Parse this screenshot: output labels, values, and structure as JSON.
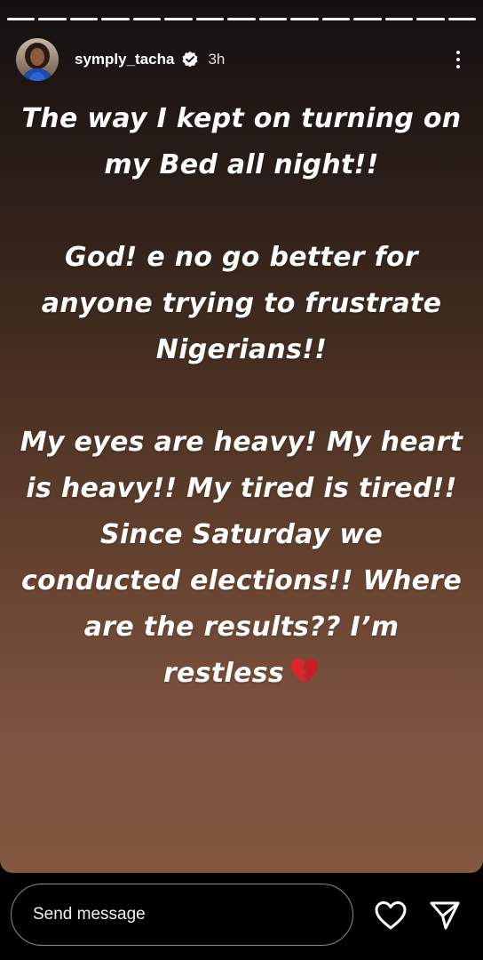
{
  "story": {
    "author": {
      "username": "symply_tacha",
      "verified": true,
      "time_ago": "3h"
    },
    "progress_segments": 15,
    "paragraphs": [
      "The way I kept on turning on my Bed all night!!",
      "God! e no go better for anyone trying to frustrate Nigerians!!",
      "My eyes are heavy! My heart is heavy!! My tired is tired!! Since Saturday we conducted elections!! Where are the results?? I’m restless"
    ],
    "trailing_emoji": "broken-heart-icon"
  },
  "footer": {
    "message_placeholder": "Send message",
    "like_icon": "heart-outline-icon",
    "share_icon": "paper-plane-icon"
  },
  "colors": {
    "gradient_top": "#141010",
    "gradient_bottom": "#83583f",
    "text": "#ffffff",
    "broken_heart": "#e0242f"
  }
}
